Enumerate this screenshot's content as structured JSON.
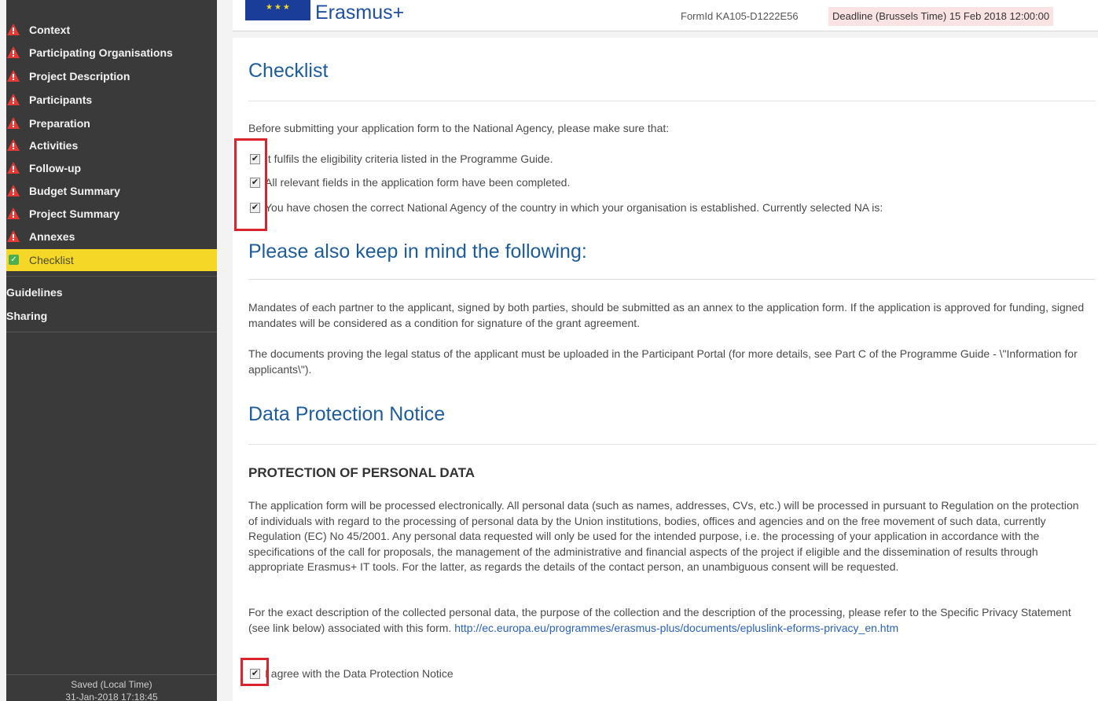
{
  "sidebar": {
    "items": [
      {
        "label": "Context",
        "status": "warning"
      },
      {
        "label": "Participating Organisations",
        "status": "warning"
      },
      {
        "label": "Project Description",
        "status": "warning"
      },
      {
        "label": "Participants",
        "status": "warning"
      },
      {
        "label": "Preparation",
        "status": "warning"
      },
      {
        "label": "Activities",
        "status": "warning"
      },
      {
        "label": "Follow-up",
        "status": "warning"
      },
      {
        "label": "Budget Summary",
        "status": "warning"
      },
      {
        "label": "Project Summary",
        "status": "warning"
      },
      {
        "label": "Annexes",
        "status": "warning"
      },
      {
        "label": "Checklist",
        "status": "complete"
      }
    ],
    "guidelines": "Guidelines",
    "sharing": "Sharing",
    "saved_label": "Saved (Local Time)",
    "saved_time": "31-Jan-2018 17:18:45"
  },
  "header": {
    "brand": "Erasmus+",
    "formid": "FormId KA105-D1222E56",
    "deadline": "Deadline (Brussels Time) 15 Feb 2018 12:00:00"
  },
  "checklist": {
    "title": "Checklist",
    "intro": "Before submitting your application form to the National Agency, please make sure that:",
    "items": [
      "It fulfils the eligibility criteria listed in the Programme Guide.",
      "All relevant fields in the application form have been completed.",
      "You have chosen the correct National Agency of the country in which your organisation is established. Currently selected NA is:"
    ]
  },
  "keep_in_mind": {
    "title": "Please also keep in mind the following:",
    "para1": "Mandates of each partner to the applicant, signed by both parties, should be submitted as an annex to the application form. If the application is approved for funding, signed mandates will be considered as a condition for signature of the grant agreement.",
    "para2": "The documents proving the legal status of the applicant must be uploaded in the Participant Portal (for more details, see Part C of the Programme Guide - \\\"Information for applicants\\\")."
  },
  "data_protection": {
    "title": "Data Protection Notice",
    "subtitle": "PROTECTION OF PERSONAL DATA",
    "para1": "The application form will be processed electronically. All personal data (such as names, addresses, CVs, etc.) will be processed in pursuant to Regulation on the protection of individuals with regard to the processing of personal data by the Union institutions, bodies, offices and agencies and on the free movement of such data, currently Regulation (EC) No 45/2001. Any personal data requested will only be used for the intended purpose, i.e. the processing of your application in accordance with the specifications of the call for proposals, the management of the administrative and financial aspects of the project if eligible and the dissemination of results through appropriate Erasmus+ IT tools. For the latter, as regards the details of the contact person, an unambiguous consent will be requested.",
    "para2": "For the exact description of the collected personal data, the purpose of the collection and the description of the processing, please refer to the Specific Privacy Statement (see link below) associated with this form.",
    "link": "http://ec.europa.eu/programmes/erasmus-plus/documents/epluslink-eforms-privacy_en.htm",
    "agree": "I agree with the Data Protection Notice"
  },
  "colors": {
    "sidebar_bg": "#3a3a3a",
    "active_bg": "#f5d827",
    "heading": "#1f5c9a",
    "highlight": "#d9232d",
    "warning": "#e53935",
    "success": "#4caf50"
  }
}
